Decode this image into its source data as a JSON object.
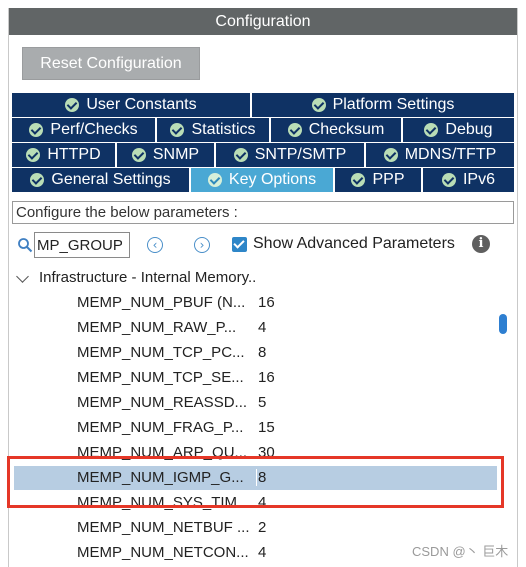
{
  "window": {
    "title": "Configuration"
  },
  "reset_button": {
    "label": "Reset Configuration"
  },
  "tabs": {
    "row1": [
      "User Constants",
      "Platform Settings"
    ],
    "row2": [
      "Perf/Checks",
      "Statistics",
      "Checksum",
      "Debug"
    ],
    "row3": [
      "HTTPD",
      "SNMP",
      "SNTP/SMTP",
      "MDNS/TFTP"
    ],
    "row4": [
      "General Settings",
      "Key Options",
      "PPP",
      "IPv6"
    ],
    "active": "Key Options"
  },
  "description": "Configure the below parameters :",
  "search": {
    "value": "MP_GROUP"
  },
  "show_advanced": {
    "label": "Show Advanced Parameters",
    "checked": true
  },
  "tree": {
    "group_label": "Infrastructure - Internal Memory..",
    "rows": [
      {
        "name": "MEMP_NUM_PBUF (N...",
        "value": "16"
      },
      {
        "name": "MEMP_NUM_RAW_P...",
        "value": "4"
      },
      {
        "name": "MEMP_NUM_TCP_PC...",
        "value": "8"
      },
      {
        "name": "MEMP_NUM_TCP_SE...",
        "value": "16"
      },
      {
        "name": "MEMP_NUM_REASSD...",
        "value": "5"
      },
      {
        "name": "MEMP_NUM_FRAG_P...",
        "value": "15"
      },
      {
        "name": "MEMP_NUM_ARP_QU...",
        "value": "30"
      },
      {
        "name": "MEMP_NUM_IGMP_G...",
        "value": "8",
        "selected": true
      },
      {
        "name": "MEMP_NUM_SYS_TIM...",
        "value": "4"
      },
      {
        "name": "MEMP_NUM_NETBUF ...",
        "value": "2"
      },
      {
        "name": "MEMP_NUM_NETCON...",
        "value": "4"
      }
    ]
  },
  "watermark": "CSDN @丶 巨木",
  "colors": {
    "tab_bg": "#0f3264",
    "tab_active": "#4aa8d4",
    "title_bg": "#616566",
    "highlight": "#e53727"
  }
}
